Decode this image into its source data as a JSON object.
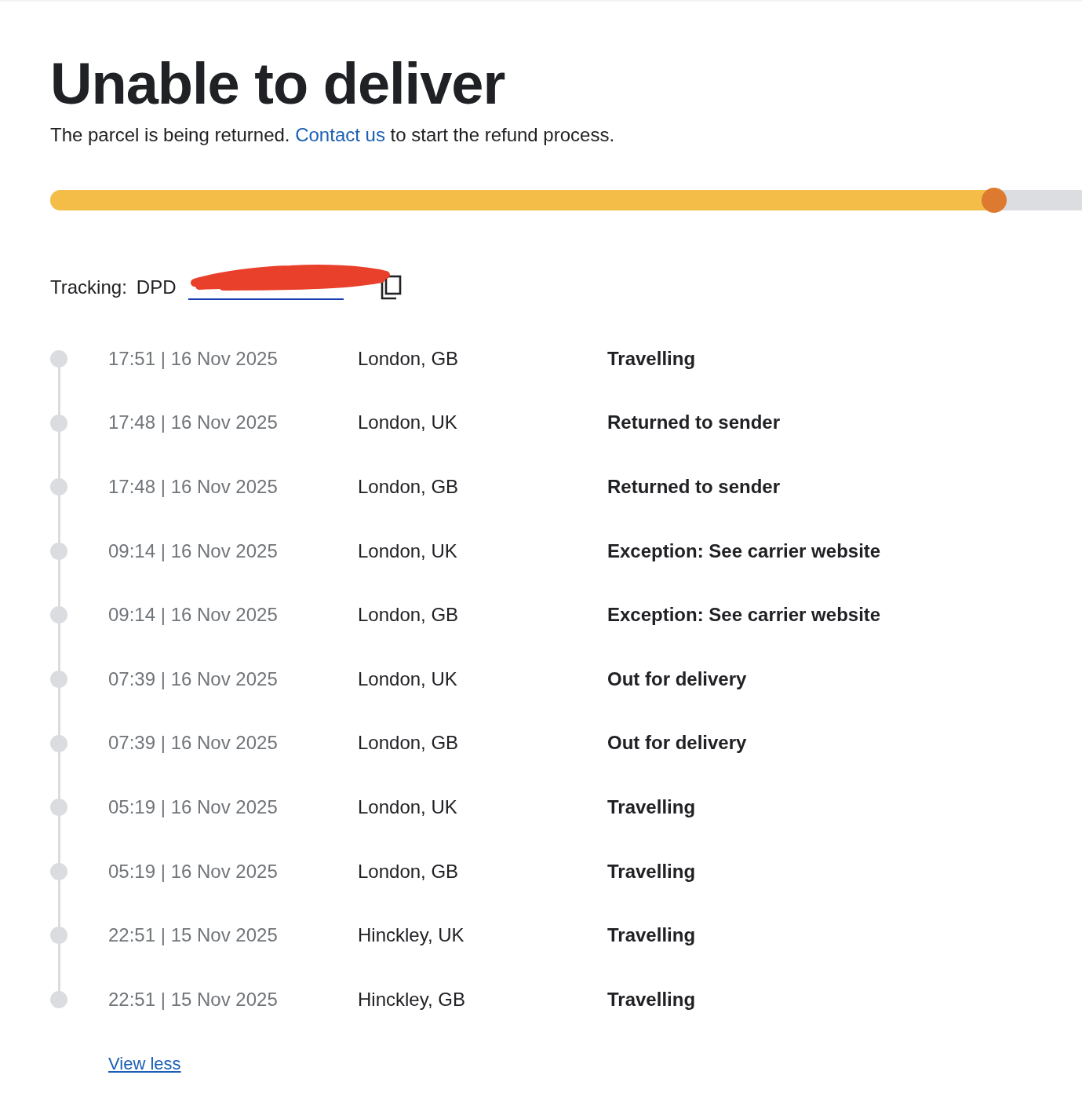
{
  "title": "Unable to deliver",
  "subtitle": {
    "before": "The parcel is being returned.",
    "link": "Contact us",
    "after": "to start the refund process."
  },
  "progress": {
    "level": 0.915
  },
  "tracking": {
    "label": "Tracking:",
    "carrier": "DPD"
  },
  "events": [
    {
      "time": "17:51 | 16 Nov 2025",
      "location": "London, GB",
      "status": "Travelling"
    },
    {
      "time": "17:48 | 16 Nov 2025",
      "location": "London, UK",
      "status": "Returned to sender"
    },
    {
      "time": "17:48 | 16 Nov 2025",
      "location": "London, GB",
      "status": "Returned to sender"
    },
    {
      "time": "09:14 | 16 Nov 2025",
      "location": "London, UK",
      "status": "Exception: See carrier website"
    },
    {
      "time": "09:14 | 16 Nov 2025",
      "location": "London, GB",
      "status": "Exception: See carrier website"
    },
    {
      "time": "07:39 | 16 Nov 2025",
      "location": "London, UK",
      "status": "Out for delivery"
    },
    {
      "time": "07:39 | 16 Nov 2025",
      "location": "London, GB",
      "status": "Out for delivery"
    },
    {
      "time": "05:19 | 16 Nov 2025",
      "location": "London, UK",
      "status": "Travelling"
    },
    {
      "time": "05:19 | 16 Nov 2025",
      "location": "London, GB",
      "status": "Travelling"
    },
    {
      "time": "22:51 | 15 Nov 2025",
      "location": "Hinckley, UK",
      "status": "Travelling"
    },
    {
      "time": "22:51 | 15 Nov 2025",
      "location": "Hinckley, GB",
      "status": "Travelling"
    }
  ],
  "view_toggle": "View less"
}
